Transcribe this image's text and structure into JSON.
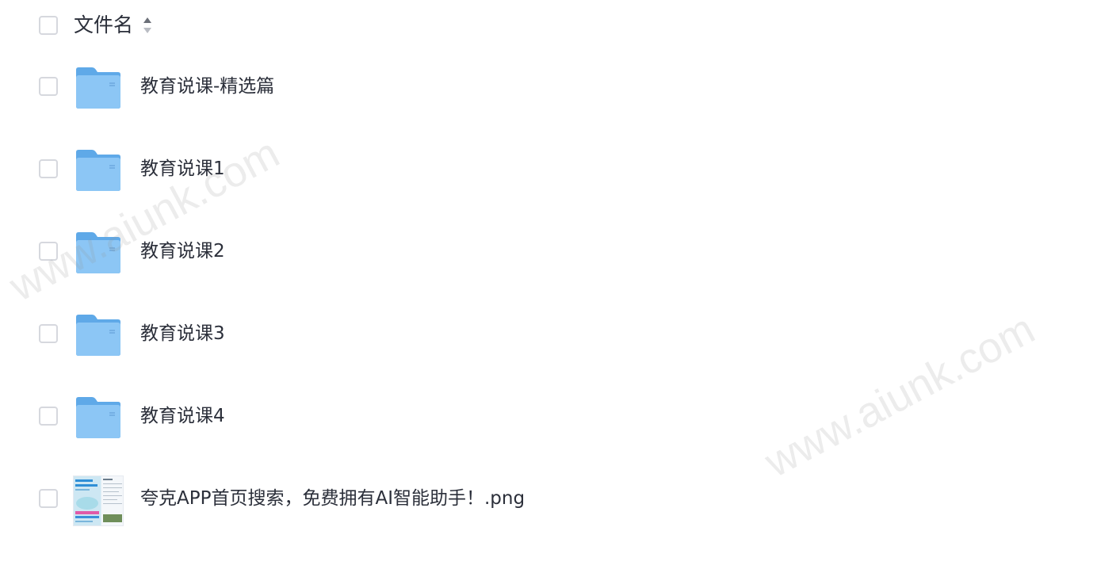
{
  "header": {
    "title": "文件名"
  },
  "files": [
    {
      "name": "教育说课-精选篇",
      "type": "folder",
      "icon": "folder-icon"
    },
    {
      "name": "教育说课1",
      "type": "folder",
      "icon": "folder-icon"
    },
    {
      "name": "教育说课2",
      "type": "folder",
      "icon": "folder-icon"
    },
    {
      "name": "教育说课3",
      "type": "folder",
      "icon": "folder-icon"
    },
    {
      "name": "教育说课4",
      "type": "folder",
      "icon": "folder-icon"
    },
    {
      "name": "夸克APP首页搜索，免费拥有AI智能助手！.png",
      "type": "image",
      "icon": "image-thumbnail"
    }
  ],
  "watermark": "www.aiunk.com",
  "colors": {
    "folder": "#6db3ef",
    "checkbox_border": "#d6d8de",
    "text": "#2b2f3a"
  }
}
